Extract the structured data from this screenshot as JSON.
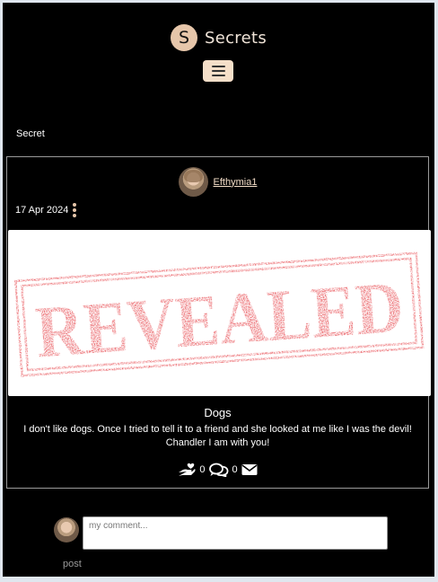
{
  "header": {
    "logo_letter": "S",
    "brand": "Secrets"
  },
  "section": {
    "label": "Secret"
  },
  "post": {
    "author": "Efthymia1",
    "date": "17 Apr 2024",
    "image_text": "REVEALED",
    "title": "Dogs",
    "body": "I don't like dogs. Once I tried to tell it to a friend and she looked at me like I was the devil! Chandler I am with you!",
    "likes_count": "0",
    "comments_count": "0"
  },
  "comment_form": {
    "placeholder": "my comment...",
    "post_label": "post"
  },
  "colors": {
    "accent": "#f5dfc9",
    "stamp_red": "#e2242b",
    "background": "#000000"
  }
}
